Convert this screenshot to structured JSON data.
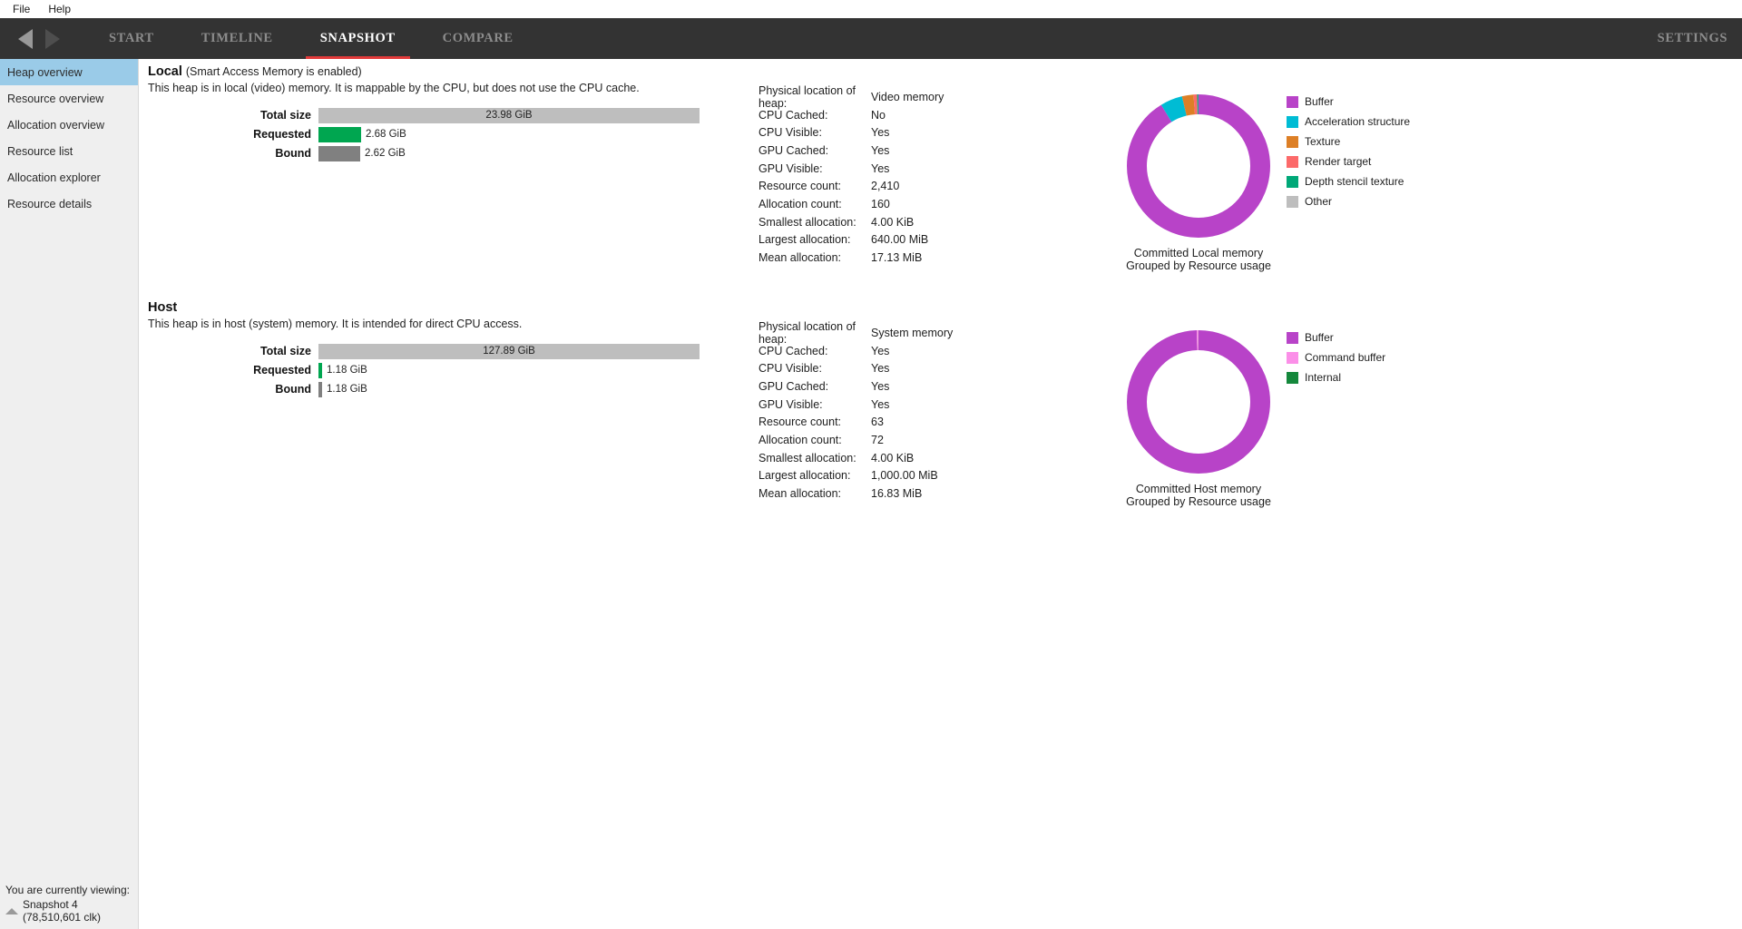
{
  "menubar": {
    "items": [
      "File",
      "Help"
    ]
  },
  "topnav": {
    "back_icon": "triangle-left-icon",
    "forward_icon": "triangle-right-icon",
    "tabs": [
      {
        "label": "START",
        "active": false
      },
      {
        "label": "TIMELINE",
        "active": false
      },
      {
        "label": "SNAPSHOT",
        "active": true
      },
      {
        "label": "COMPARE",
        "active": false
      }
    ],
    "settings_label": "SETTINGS",
    "accent_color": "#e23a3a"
  },
  "sidebar": {
    "items": [
      {
        "label": "Heap overview",
        "active": true
      },
      {
        "label": "Resource overview",
        "active": false
      },
      {
        "label": "Allocation overview",
        "active": false
      },
      {
        "label": "Resource list",
        "active": false
      },
      {
        "label": "Allocation explorer",
        "active": false
      },
      {
        "label": "Resource details",
        "active": false
      }
    ],
    "selection_color": "#9acbe8",
    "status": {
      "line1": "You are currently viewing:",
      "line2": "Snapshot 4 (78,510,601 clk)",
      "icon": "chevron-up-icon"
    }
  },
  "heaps": [
    {
      "id": "local",
      "title": "Local",
      "note": "(Smart Access Memory is enabled)",
      "description": "This heap is in local (video) memory. It is mappable by the CPU, but does not use the CPU cache.",
      "bars": [
        {
          "label": "Total size",
          "value": "23.98 GiB",
          "fraction": 1.0,
          "color": "#bebebe",
          "value_inside": true
        },
        {
          "label": "Requested",
          "value": "2.68 GiB",
          "fraction": 0.1118,
          "color": "#00a650",
          "value_inside": false
        },
        {
          "label": "Bound",
          "value": "2.62 GiB",
          "fraction": 0.1093,
          "color": "#808080",
          "value_inside": false
        }
      ],
      "properties": [
        {
          "key": "Physical location of heap:",
          "value": "Video memory"
        },
        {
          "key": "CPU Cached:",
          "value": "No"
        },
        {
          "key": "CPU Visible:",
          "value": "Yes"
        },
        {
          "key": "GPU Cached:",
          "value": "Yes"
        },
        {
          "key": "GPU Visible:",
          "value": "Yes"
        },
        {
          "key": "Resource count:",
          "value": "2,410"
        },
        {
          "key": "Allocation count:",
          "value": "160"
        },
        {
          "key": "Smallest allocation:",
          "value": "4.00 KiB"
        },
        {
          "key": "Largest allocation:",
          "value": "640.00 MiB"
        },
        {
          "key": "Mean allocation:",
          "value": "17.13 MiB"
        }
      ],
      "chart_caption": "Committed Local memory\nGrouped by Resource usage"
    },
    {
      "id": "host",
      "title": "Host",
      "note": "",
      "description": "This heap is in host (system) memory. It is intended for direct CPU access.",
      "bars": [
        {
          "label": "Total size",
          "value": "127.89 GiB",
          "fraction": 1.0,
          "color": "#bebebe",
          "value_inside": true
        },
        {
          "label": "Requested",
          "value": "1.18 GiB",
          "fraction": 0.0092,
          "color": "#00a650",
          "value_inside": false
        },
        {
          "label": "Bound",
          "value": "1.18 GiB",
          "fraction": 0.0092,
          "color": "#808080",
          "value_inside": false
        }
      ],
      "properties": [
        {
          "key": "Physical location of heap:",
          "value": "System memory"
        },
        {
          "key": "CPU Cached:",
          "value": "Yes"
        },
        {
          "key": "CPU Visible:",
          "value": "Yes"
        },
        {
          "key": "GPU Cached:",
          "value": "Yes"
        },
        {
          "key": "GPU Visible:",
          "value": "Yes"
        },
        {
          "key": "Resource count:",
          "value": "63"
        },
        {
          "key": "Allocation count:",
          "value": "72"
        },
        {
          "key": "Smallest allocation:",
          "value": "4.00 KiB"
        },
        {
          "key": "Largest allocation:",
          "value": "1,000.00 MiB"
        },
        {
          "key": "Mean allocation:",
          "value": "16.83 MiB"
        }
      ],
      "chart_caption": "Committed Host memory\nGrouped by Resource usage"
    }
  ],
  "chart_data": [
    {
      "type": "pie",
      "variant": "donut",
      "title": "Committed Local memory",
      "subtitle": "Grouped by Resource usage",
      "start_angle_deg": 0,
      "direction": "clockwise",
      "categories": [
        "Buffer",
        "Acceleration structure",
        "Texture",
        "Render target",
        "Depth stencil texture",
        "Other"
      ],
      "values": [
        91.2,
        5.0,
        2.6,
        0.8,
        0.3,
        0.1
      ],
      "unit": "percent",
      "colors": [
        "#b843c8",
        "#00bcd4",
        "#dd7f26",
        "#fc6a6a",
        "#00a878",
        "#bebebe"
      ],
      "legend_position": "right"
    },
    {
      "type": "pie",
      "variant": "donut",
      "title": "Committed Host memory",
      "subtitle": "Grouped by Resource usage",
      "start_angle_deg": 0,
      "direction": "clockwise",
      "categories": [
        "Buffer",
        "Command buffer",
        "Internal"
      ],
      "values": [
        99.5,
        0.4,
        0.1
      ],
      "unit": "percent",
      "colors": [
        "#b843c8",
        "#fb8fe8",
        "#15883c"
      ],
      "legend_position": "right"
    }
  ],
  "legends": [
    {
      "items": [
        {
          "label": "Buffer",
          "color": "#b843c8"
        },
        {
          "label": "Acceleration structure",
          "color": "#00bcd4"
        },
        {
          "label": "Texture",
          "color": "#dd7f26"
        },
        {
          "label": "Render target",
          "color": "#fc6a6a"
        },
        {
          "label": "Depth stencil texture",
          "color": "#00a878"
        },
        {
          "label": "Other",
          "color": "#bebebe"
        }
      ]
    },
    {
      "items": [
        {
          "label": "Buffer",
          "color": "#b843c8"
        },
        {
          "label": "Command buffer",
          "color": "#fb8fe8"
        },
        {
          "label": "Internal",
          "color": "#15883c"
        }
      ]
    }
  ]
}
